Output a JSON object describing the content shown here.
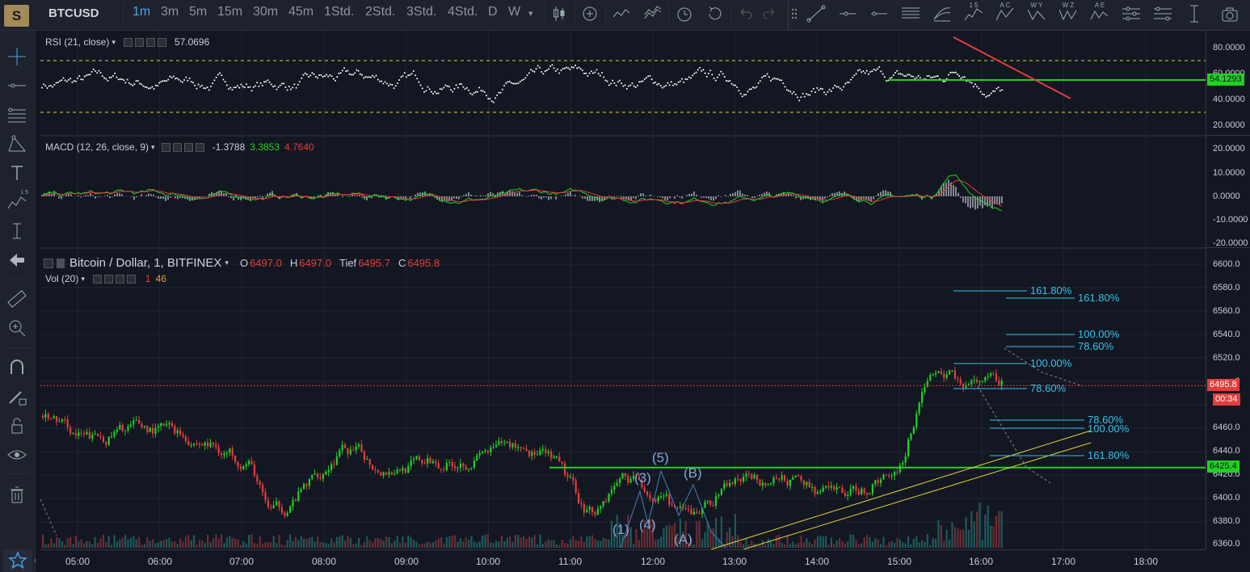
{
  "toolbar": {
    "logo": "S",
    "symbol": "BTCUSD",
    "timeframes": [
      "1m",
      "3m",
      "5m",
      "15m",
      "30m",
      "45m",
      "1Std.",
      "2Std.",
      "3Std.",
      "4Std.",
      "D",
      "W"
    ],
    "active_timeframe": "1m",
    "icons": [
      "candles-icon",
      "add-indicator-icon",
      "compare-icon",
      "indicators-icon",
      "alert-icon",
      "replay-icon",
      "undo-icon",
      "redo-icon"
    ],
    "drawing_icons": [
      "trend-line-icon",
      "horizontal-ray-icon",
      "horizontal-line-icon",
      "parallel-channel-icon",
      "fib-retracement-icon",
      "elliott-12345-icon",
      "elliott-abc-icon",
      "elliott-wxy-icon",
      "elliott-wxyxz-icon",
      "elliott-abcde-icon",
      "fib-channel-icon",
      "fib-timezone-icon",
      "vertical-line-icon",
      "camera-icon"
    ],
    "drawing_icon_labels": {
      "elliott-12345-icon": "1 5",
      "elliott-abc-icon": "A C",
      "elliott-wxy-icon": "W Y",
      "elliott-wxyxz-icon": "W Z",
      "elliott-abcde-icon": "A E"
    }
  },
  "left_toolbar": {
    "icons": [
      "crosshair-icon",
      "line-tool-icon",
      "fib-tool-icon",
      "pattern-tool-icon",
      "text-tool-icon",
      "elliott-tool-icon",
      "measure-icon",
      "back-arrow-icon",
      "ruler-icon",
      "zoom-icon",
      "magnet-icon",
      "pencil-lock-icon",
      "lock-icon",
      "eye-icon",
      "trash-icon",
      "star-icon"
    ],
    "elliott_label": "1 5"
  },
  "rsi": {
    "label": "RSI (21, close)",
    "value": "57.0696",
    "axis": [
      "80.0000",
      "60.0000",
      "40.0000",
      "20.0000"
    ],
    "current_tag": "54.1293",
    "line_color": "#ffffff",
    "band_color": "#e0d43a"
  },
  "macd": {
    "label": "MACD (12, 26, close, 9)",
    "v1": "-1.3788",
    "v2": "3.3853",
    "v3": "4.7640",
    "axis": [
      "20.0000",
      "10.0000",
      "0.0000",
      "-10.0000",
      "-20.0000"
    ],
    "macd_color": "#21d121",
    "signal_color": "#e43d3d"
  },
  "main": {
    "title": "Bitcoin / Dollar, 1, BITFINEX",
    "ohlc": [
      {
        "k": "O",
        "v": "6497.0"
      },
      {
        "k": "H",
        "v": "6497.0"
      },
      {
        "k": "Tief",
        "v": "6495.7"
      },
      {
        "k": "C",
        "v": "6495.8"
      }
    ],
    "vol_label": "Vol (20)",
    "vol_v1": "1",
    "vol_v2": "46",
    "axis": [
      "6600.0",
      "6580.0",
      "6560.0",
      "6540.0",
      "6520.0",
      "6480.0",
      "6460.0",
      "6440.0",
      "6420.0",
      "6400.0",
      "6380.0",
      "6360.0"
    ],
    "axis_partial": "6500.0",
    "price_tag": "6495.8",
    "countdown": "00:34",
    "level_tag": "6425.4",
    "up_color": "#21d121",
    "down_color": "#e43d3d"
  },
  "fib_labels": [
    "161.80%",
    "161.80%",
    "100.00%",
    "78.60%",
    "100.00%",
    "78.60%",
    "78.60%",
    "100.00%",
    "161.80%"
  ],
  "wave_labels": [
    "(5)",
    "(3)",
    "(B)",
    "(1)",
    "(4)",
    "(A)"
  ],
  "time_axis": [
    "05:00",
    "06:00",
    "07:00",
    "08:00",
    "09:00",
    "10:00",
    "11:00",
    "12:00",
    "13:00",
    "14:00",
    "15:00",
    "16:00",
    "17:00",
    "18:00"
  ]
}
